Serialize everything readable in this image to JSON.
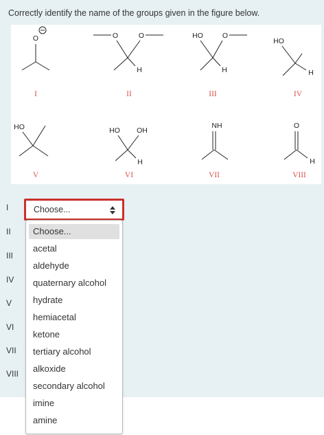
{
  "question": "Correctly identify the name of the groups given in the figure below.",
  "figure": {
    "roman_labels": [
      "I",
      "II",
      "III",
      "IV",
      "V",
      "VI",
      "VII",
      "VIII"
    ],
    "atom_labels": {
      "o": "O",
      "h": "H",
      "ho": "HO",
      "oh": "OH",
      "nh": "NH"
    }
  },
  "row_labels": [
    "I",
    "II",
    "III",
    "IV",
    "V",
    "VI",
    "VII",
    "VIII"
  ],
  "select": {
    "value": "Choose..."
  },
  "dropdown": {
    "options": [
      "Choose...",
      "acetal",
      "aldehyde",
      "quaternary alcohol",
      "hydrate",
      "hemiacetal",
      "ketone",
      "tertiary alcohol",
      "alkoxide",
      "secondary alcohol",
      "imine",
      "amine"
    ],
    "highlighted": "Choose..."
  }
}
